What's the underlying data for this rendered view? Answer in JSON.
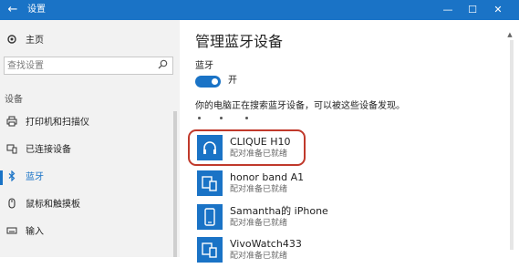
{
  "window": {
    "title": "设置",
    "controls": {
      "minimize": "—",
      "maximize": "☐",
      "close": "✕"
    }
  },
  "sidebar": {
    "home_label": "主页",
    "search_placeholder": "查找设置",
    "section_header": "设备",
    "items": [
      {
        "label": "打印机和扫描仪",
        "icon": "printer-icon",
        "active": false
      },
      {
        "label": "已连接设备",
        "icon": "connected-devices-icon",
        "active": false
      },
      {
        "label": "蓝牙",
        "icon": "bluetooth-icon",
        "active": true
      },
      {
        "label": "鼠标和触摸板",
        "icon": "mouse-icon",
        "active": false
      },
      {
        "label": "输入",
        "icon": "keyboard-icon",
        "active": false
      }
    ]
  },
  "main": {
    "title": "管理蓝牙设备",
    "bluetooth_label": "蓝牙",
    "toggle_state": "开",
    "toggle_on": true,
    "status_text": "你的电脑正在搜索蓝牙设备，可以被这些设备发现。",
    "devices": [
      {
        "name": "CLIQUE H10",
        "status": "配对准备已就绪",
        "icon": "headphones-icon",
        "highlighted": true
      },
      {
        "name": "honor band A1",
        "status": "配对准备已就绪",
        "icon": "device-icon",
        "highlighted": false
      },
      {
        "name": "Samantha的 iPhone",
        "status": "配对准备已就绪",
        "icon": "phone-icon",
        "highlighted": false
      },
      {
        "name": "VivoWatch433",
        "status": "配对准备已就绪",
        "icon": "device-icon",
        "highlighted": false
      }
    ]
  },
  "colors": {
    "accent": "#1a73c6",
    "highlight": "#c0392b",
    "sidebar_bg": "#f2f2f2"
  }
}
